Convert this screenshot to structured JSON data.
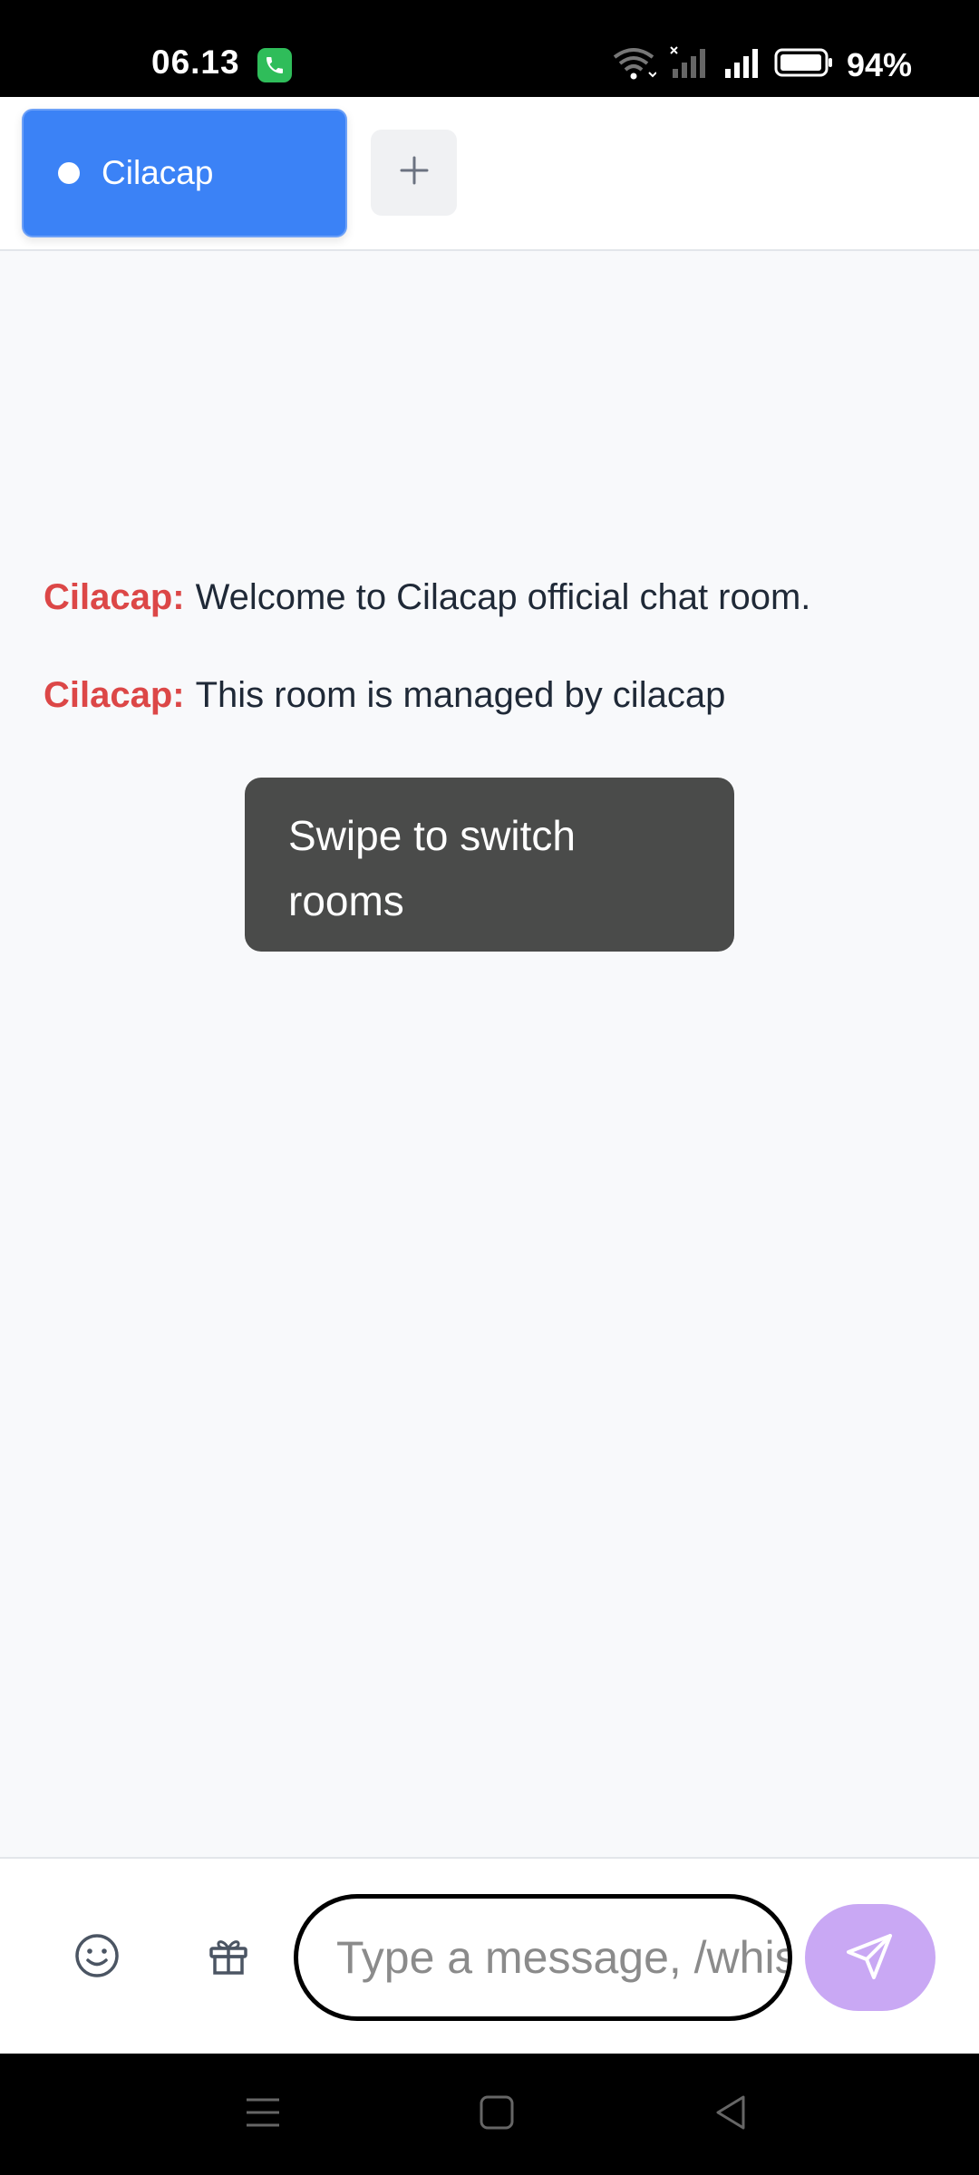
{
  "status_bar": {
    "time": "06.13",
    "battery": "94%",
    "icons": [
      "phone-call-icon",
      "wifi-icon",
      "signal-no-sim-icon",
      "signal-icon",
      "battery-icon"
    ]
  },
  "tabs": {
    "active_room": "Cilacap",
    "add_icon": "plus-icon"
  },
  "messages": [
    {
      "sender": "Cilacap:",
      "text": "Welcome to Cilacap official chat room."
    },
    {
      "sender": "Cilacap:",
      "text": "This room is managed by cilacap"
    }
  ],
  "toast": {
    "text": "Swipe to switch rooms"
  },
  "input_bar": {
    "placeholder": "Type a message, /whisper",
    "icons": [
      "emoji-icon",
      "gift-icon",
      "send-icon"
    ]
  },
  "colors": {
    "accent": "#3b82f6",
    "sender": "#dc4747",
    "send_button": "#c9a8f4",
    "toast_bg": "#4a4b4a"
  }
}
